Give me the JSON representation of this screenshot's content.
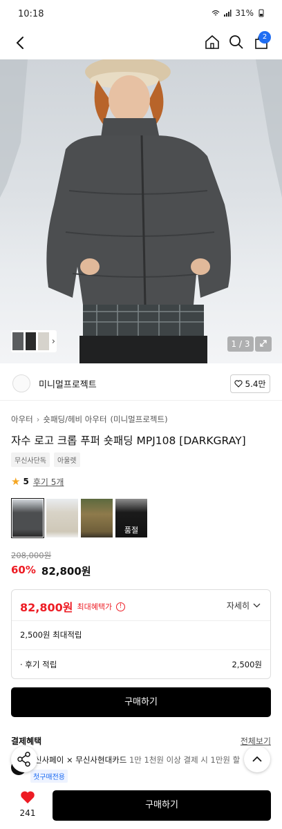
{
  "status": {
    "time": "10:18",
    "battery": "31%"
  },
  "nav": {
    "bag_count": "2"
  },
  "hero": {
    "page_indicator": "1 / 3"
  },
  "brand": {
    "name": "미니멀프로젝트",
    "likes": "5.4만"
  },
  "breadcrumb": [
    "아우터",
    "숏패딩/헤비 아우터",
    "(미니멀프로젝트)"
  ],
  "product": {
    "title": "자수 로고 크롭 푸퍼 숏패딩 MPJ108 [DARKGRAY]",
    "tags": [
      "무신사단독",
      "아울렛"
    ]
  },
  "rating": {
    "score": "5",
    "reviews": "후기 5개"
  },
  "color_options": [
    {
      "label": ""
    },
    {
      "label": ""
    },
    {
      "label": ""
    },
    {
      "label": "품절"
    }
  ],
  "price": {
    "original": "208,000원",
    "discount": "60%",
    "sale": "82,800원"
  },
  "benefit": {
    "max_price": "82,800원",
    "max_label": "최대혜택가",
    "info": "!",
    "detail_label": "자세히",
    "points": "2,500원 최대적립",
    "review_points_label": "· 후기 적립",
    "review_points_value": "2,500원"
  },
  "buy_label": "구매하기",
  "payment": {
    "title": "결제혜택",
    "view_all": "전체보기",
    "line_main": "신사페이 × 무신사현대카드",
    "line_detail": "1만 1천원 이상 결제 시 1만원 할",
    "badge": "첫구매전용"
  },
  "bottom": {
    "heart_count": "241",
    "buy_label": "구매하기"
  },
  "colors": {
    "sale_red": "#ed1c24",
    "accent_blue": "#1f6df2",
    "black": "#000000"
  },
  "icons": [
    "back-icon",
    "home-icon",
    "search-icon",
    "bag-icon",
    "heart-icon",
    "share-icon",
    "chevron-up-icon",
    "expand-icon",
    "star-icon"
  ]
}
